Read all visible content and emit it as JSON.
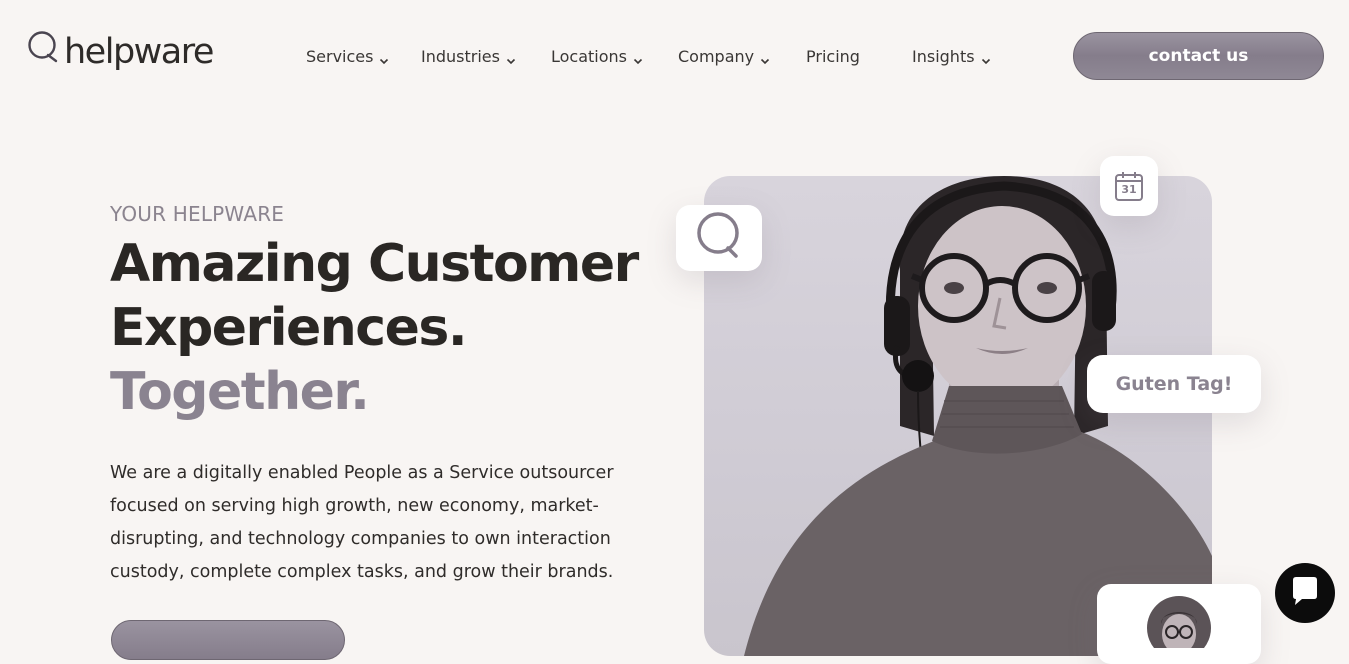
{
  "brand": {
    "logo_text": "helpware"
  },
  "nav": {
    "items": [
      {
        "label": "Services",
        "dropdown": true
      },
      {
        "label": "Industries",
        "dropdown": true
      },
      {
        "label": "Locations",
        "dropdown": true
      },
      {
        "label": "Company",
        "dropdown": true
      },
      {
        "label": "Pricing",
        "dropdown": false
      },
      {
        "label": "Insights",
        "dropdown": true
      }
    ],
    "contact_label": "contact us"
  },
  "hero": {
    "eyebrow": "YOUR HELPWARE",
    "headline_line1": "Amazing Customer",
    "headline_line2": "Experiences.",
    "headline_accent": "Together.",
    "description": "We are a digitally enabled People as a Service outsourcer focused on serving high growth, new economy, market-disrupting, and technology companies to own interaction custody, complete complex tasks, and grow their brands."
  },
  "floating": {
    "greeting": "Guten Tag!",
    "calendar_day": "31",
    "chat_icon": "speech-bubble-icon",
    "calendar_icon": "calendar-icon"
  },
  "widget": {
    "icon": "chat-bubble-icon"
  },
  "colors": {
    "background": "#f8f5f3",
    "accent": "#8a8390",
    "button": "#8f8895",
    "text": "#2a2724",
    "widget": "#0c0c0c"
  }
}
